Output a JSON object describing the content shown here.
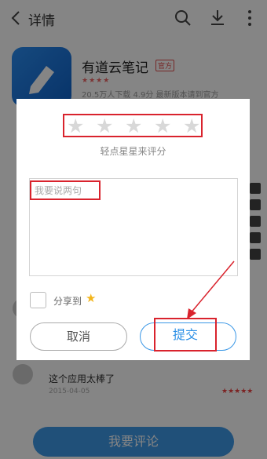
{
  "topbar": {
    "title": "详情"
  },
  "app": {
    "name": "有道云笔记",
    "badge": "官方",
    "rating_stars": "★★★★",
    "meta": "20.5万人下载   4.9分   最新版本请到官方"
  },
  "reviews": {
    "text": "这个应用太棒了",
    "date": "2015-04-05",
    "stars": "★★★★★"
  },
  "bottom": {
    "button_label": "我要评论"
  },
  "dialog": {
    "stars": [
      "★",
      "★",
      "★",
      "★",
      "★"
    ],
    "hint": "轻点星星来评分",
    "comment_placeholder": "我要说两句",
    "share_label": "分享到",
    "cancel_label": "取消",
    "submit_label": "提交"
  },
  "colors": {
    "accent": "#2b8fe6",
    "highlight": "#d9232d",
    "star_empty": "#d8d8d8",
    "share_star": "#f3b51b"
  }
}
